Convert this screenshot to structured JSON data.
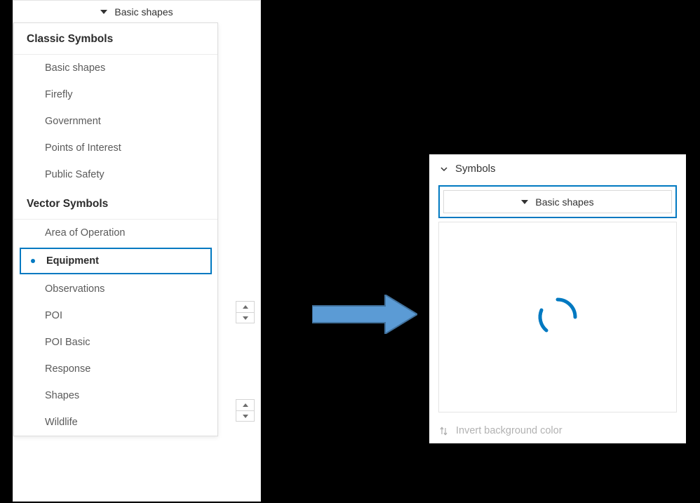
{
  "left": {
    "selector_label": "Basic shapes",
    "groups": [
      {
        "header": "Classic Symbols",
        "items": [
          {
            "label": "Basic shapes",
            "selected": false
          },
          {
            "label": "Firefly",
            "selected": false
          },
          {
            "label": "Government",
            "selected": false
          },
          {
            "label": "Points of Interest",
            "selected": false
          },
          {
            "label": "Public Safety",
            "selected": false
          }
        ]
      },
      {
        "header": "Vector Symbols",
        "items": [
          {
            "label": "Area of Operation",
            "selected": false
          },
          {
            "label": "Equipment",
            "selected": true
          },
          {
            "label": "Observations",
            "selected": false
          },
          {
            "label": "POI",
            "selected": false
          },
          {
            "label": "POI Basic",
            "selected": false
          },
          {
            "label": "Response",
            "selected": false
          },
          {
            "label": "Shapes",
            "selected": false
          },
          {
            "label": "Wildlife",
            "selected": false
          }
        ]
      }
    ]
  },
  "right": {
    "section_title": "Symbols",
    "selector_label": "Basic shapes",
    "invert_label": "Invert background color"
  },
  "colors": {
    "accent": "#0079c1",
    "arrow_fill": "#5b9bd5",
    "arrow_stroke": "#41719c"
  }
}
